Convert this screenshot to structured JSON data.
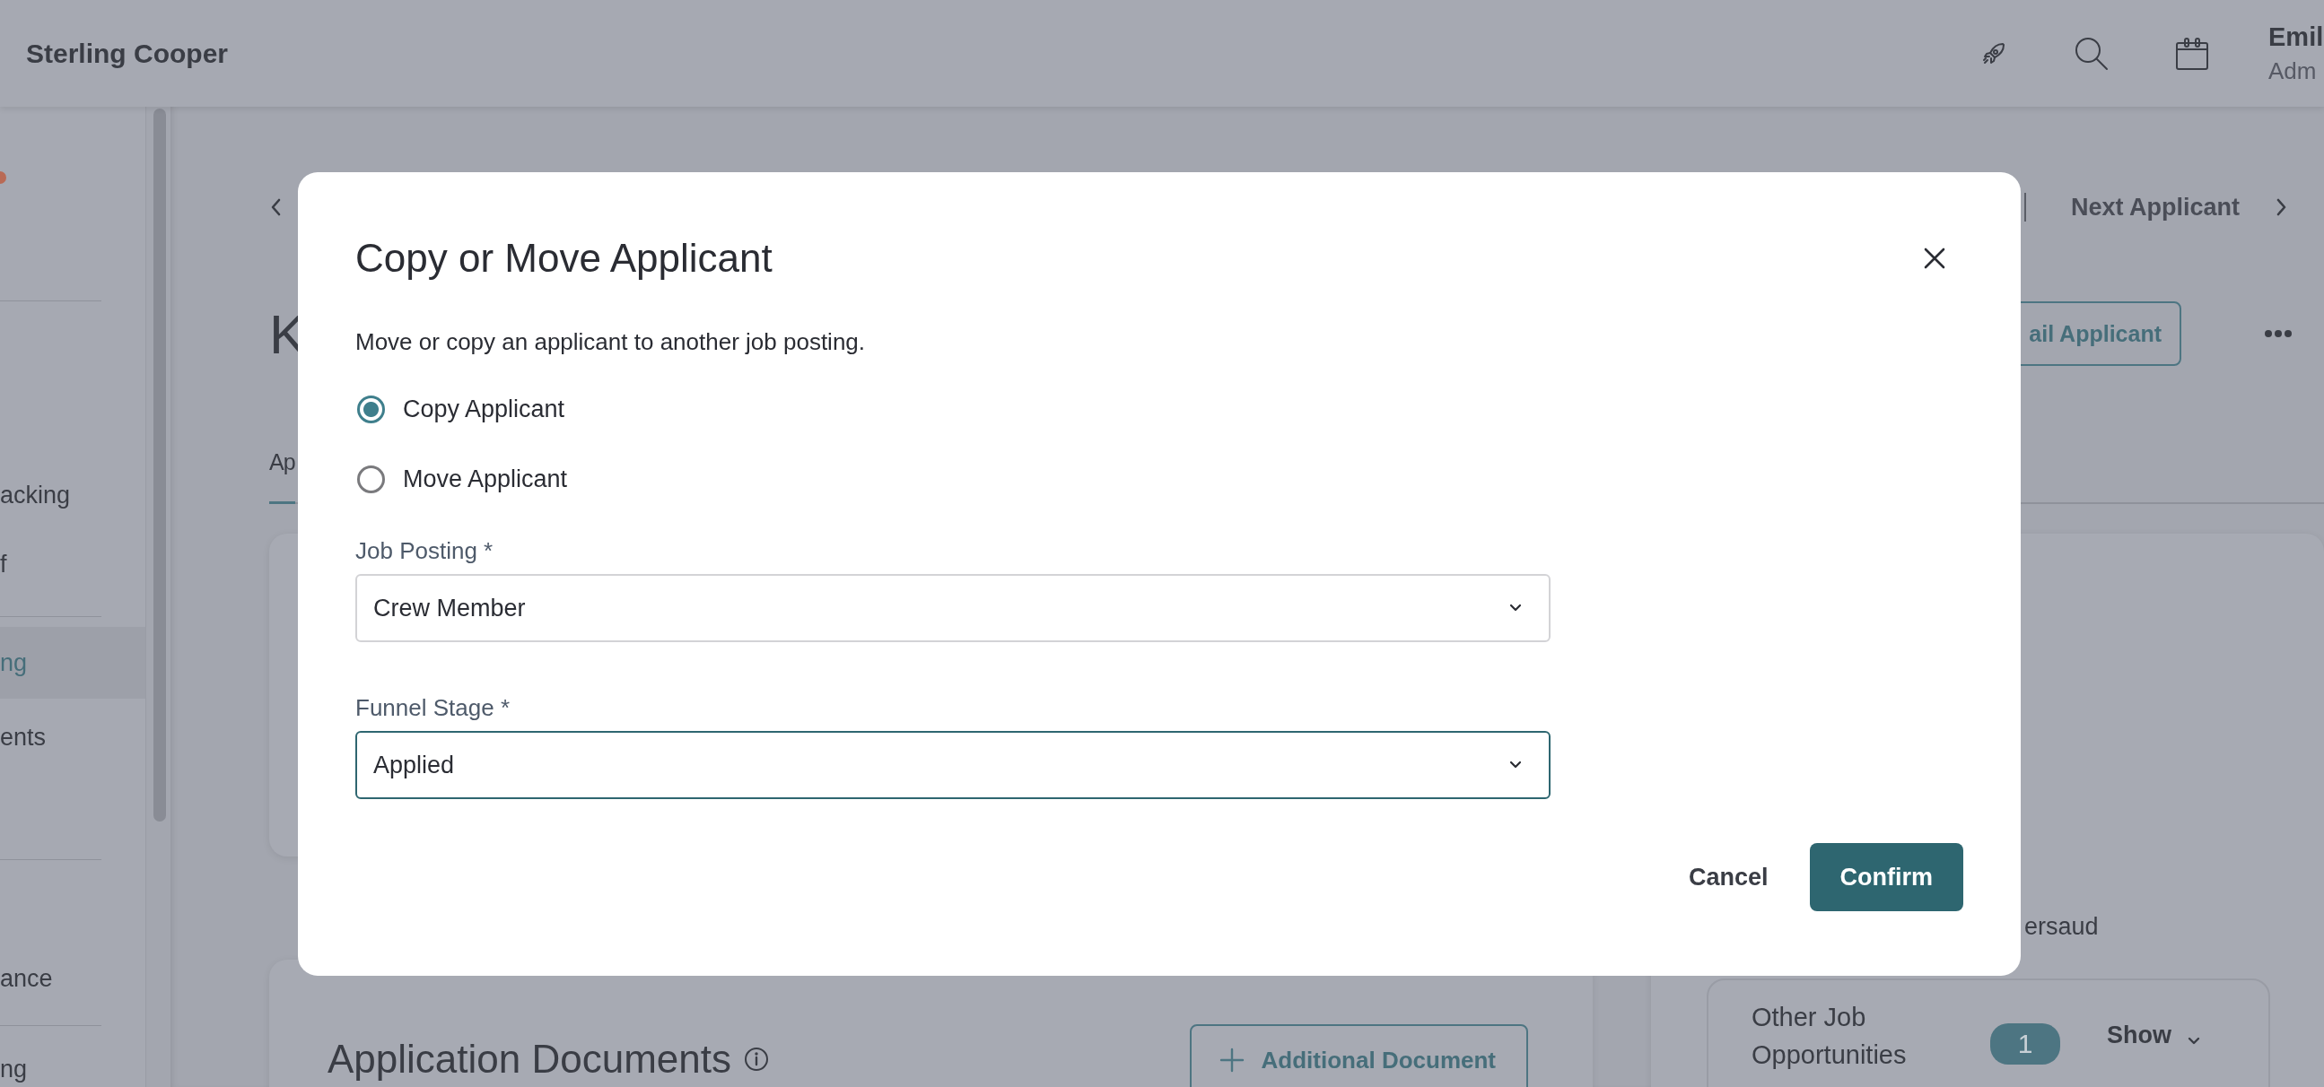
{
  "top_bar": {
    "brand": "Sterling Cooper",
    "user_name": "Emil",
    "user_role": "Adm"
  },
  "sidebar": {
    "groups": [
      {
        "items": [
          {
            "label": "acking",
            "selected": false
          },
          {
            "label": "f",
            "selected": false
          }
        ]
      },
      {
        "items": [
          {
            "label": "ng",
            "selected": true
          },
          {
            "label": "ents",
            "selected": false
          }
        ]
      },
      {
        "items": [
          {
            "label": "ance",
            "selected": false
          }
        ]
      },
      {
        "items": [
          {
            "label": "ng",
            "selected": false
          }
        ]
      }
    ]
  },
  "page": {
    "title": "K",
    "tabs": [
      {
        "label": "Ap",
        "selected": true
      }
    ],
    "next_link": "Next Applicant",
    "email_button": "ail Applicant",
    "documents": {
      "title": "Application Documents",
      "add_button": "Additional Document"
    },
    "side_panel": {
      "assignee": "ersaud",
      "opportunities": {
        "label_line_1": "Other Job",
        "label_line_2": "Opportunities",
        "count": "1",
        "toggle": "Show"
      }
    }
  },
  "dialog": {
    "title": "Copy or Move Applicant",
    "description": "Move or copy an applicant to another job posting.",
    "options": [
      {
        "label": "Copy Applicant",
        "selected": true
      },
      {
        "label": "Move Applicant",
        "selected": false
      }
    ],
    "fields": [
      {
        "label": "Job Posting *",
        "value": "Crew Member",
        "focused": false
      },
      {
        "label": "Funnel Stage *",
        "value": "Applied",
        "focused": true
      }
    ],
    "buttons": [
      {
        "kind": "secondary",
        "label": "Cancel"
      },
      {
        "kind": "primary",
        "label": "Confirm"
      }
    ]
  }
}
